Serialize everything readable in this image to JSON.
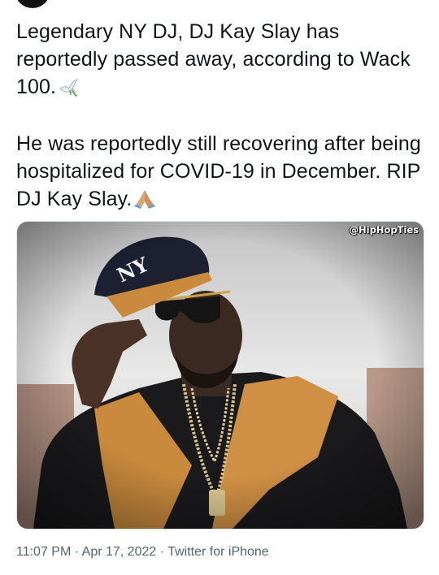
{
  "tweet": {
    "paragraph1": "Legendary NY DJ, DJ Kay Slay has reportedly passed away, according to Wack 100.",
    "paragraph2": "He was reportedly still recovering after being hospitalized for COVID-19 in December. RIP DJ Kay Slay.",
    "emoji1": "dove-emoji",
    "emoji2": "folded-hands-emoji"
  },
  "media": {
    "watermark": "@HipHopTies",
    "cap_logo": "NY"
  },
  "meta": {
    "time": "11:07 PM",
    "separator": "·",
    "date": "Apr 17, 2022",
    "source": "Twitter for iPhone"
  }
}
